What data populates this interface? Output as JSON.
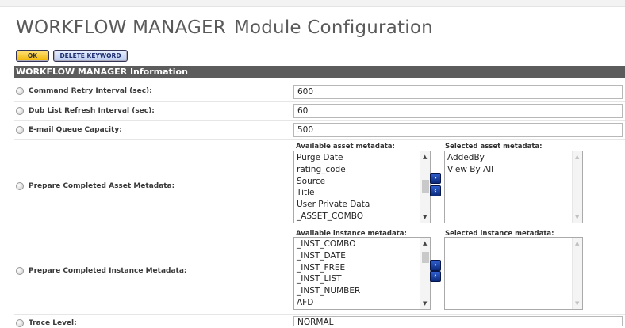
{
  "page": {
    "title_main": "WORKFLOW MANAGER",
    "title_sub": "Module Configuration"
  },
  "toolbar": {
    "ok_label": "OK",
    "delete_keyword_label": "DELETE KEYWORD"
  },
  "section": {
    "title": "WORKFLOW MANAGER Information"
  },
  "fields": {
    "command_retry": {
      "label": "Command Retry Interval (sec):",
      "value": "600"
    },
    "dub_list_refresh": {
      "label": "Dub List Refresh Interval (sec):",
      "value": "60"
    },
    "email_queue": {
      "label": "E-mail Queue Capacity:",
      "value": "500"
    },
    "trace_level": {
      "label": "Trace Level:",
      "value": "NORMAL"
    }
  },
  "asset_metadata": {
    "label": "Prepare Completed Asset Metadata:",
    "available_header": "Available asset metadata:",
    "selected_header": "Selected asset metadata:",
    "available": [
      "Purge Date",
      "rating_code",
      "Source",
      "Title",
      "User Private Data",
      "_ASSET_COMBO"
    ],
    "selected": [
      "AddedBy",
      "View By All"
    ]
  },
  "instance_metadata": {
    "label": "Prepare Completed Instance Metadata:",
    "available_header": "Available instance metadata:",
    "selected_header": "Selected instance metadata:",
    "available": [
      "_INST_COMBO",
      "_INST_DATE",
      "_INST_FREE",
      "_INST_LIST",
      "_INST_NUMBER",
      "AFD"
    ],
    "selected": []
  },
  "icons": {
    "move_right": "›",
    "move_left": "‹",
    "scroll_up": "▲",
    "scroll_down": "▼"
  },
  "colors": {
    "section_bar": "#5c5c5c",
    "ok_button": "#f5c518",
    "delete_button": "#c8d6f5",
    "move_button": "#1a3f9e"
  }
}
